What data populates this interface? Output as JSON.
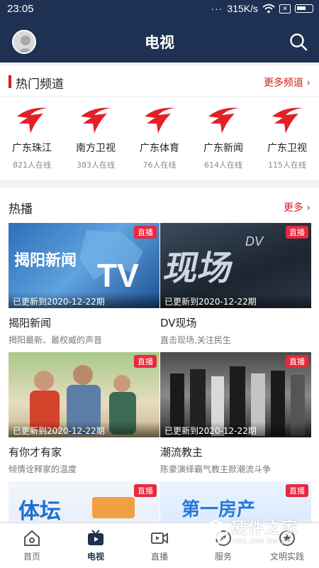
{
  "status": {
    "time": "23:05",
    "dots": "···",
    "speed": "315K/s",
    "x_label": "✕"
  },
  "header": {
    "title": "电视"
  },
  "channels_section": {
    "title": "热门频道",
    "more": "更多频道",
    "items": [
      {
        "name": "广东珠江",
        "online": "821人在线"
      },
      {
        "name": "南方卫视",
        "online": "383人在线"
      },
      {
        "name": "广东体育",
        "online": "76人在线"
      },
      {
        "name": "广东新闻",
        "online": "614人在线"
      },
      {
        "name": "广东卫视",
        "online": "115人在线"
      }
    ]
  },
  "hot_section": {
    "title": "热播",
    "more": "更多",
    "items": [
      {
        "title": "揭阳新闻",
        "desc": "揭阳最新、最权威的声音",
        "updated": "已更新到2020-12-22期",
        "badge": "直播",
        "poster": "揭阳新闻",
        "poster_tag": "TV"
      },
      {
        "title": "DV现场",
        "desc": "直击现场,关注民生",
        "updated": "已更新到2020-12-22期",
        "badge": "直播",
        "poster": "现场",
        "poster_tag": "DV"
      },
      {
        "title": "有你才有家",
        "desc": "倾情诠释家的温度",
        "updated": "已更新到2020-12-22期",
        "badge": "直播"
      },
      {
        "title": "潮流教主",
        "desc": "陈豪演绎霸气教主掀潮流斗争",
        "updated": "已更新到2020-12-22期",
        "badge": "直播"
      },
      {
        "badge": "直播",
        "poster": "体坛"
      },
      {
        "badge": "直播",
        "poster": "第一房产"
      }
    ]
  },
  "bottom_nav": {
    "items": [
      {
        "label": "首页",
        "icon": "home-icon"
      },
      {
        "label": "电视",
        "icon": "tv-icon"
      },
      {
        "label": "直播",
        "icon": "video-camera-icon"
      },
      {
        "label": "服务",
        "icon": "compass-icon"
      },
      {
        "label": "文明实践",
        "icon": "star-icon"
      }
    ]
  },
  "watermark": {
    "text": "硬件之家",
    "sub": "YING JIAN ZHI JIA"
  },
  "colors": {
    "header": "#1e3152",
    "accent": "#d21c1c",
    "live_badge": "#e8283c"
  }
}
